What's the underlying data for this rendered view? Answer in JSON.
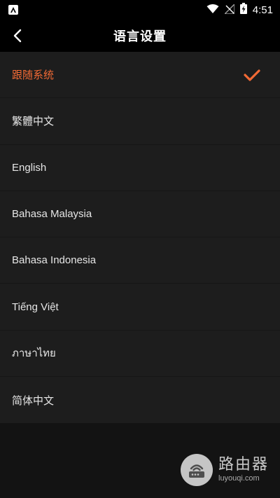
{
  "status_bar": {
    "time": "4:51",
    "icons": [
      "app-notification-icon",
      "wifi-icon",
      "no-sim-icon",
      "battery-charging-icon"
    ]
  },
  "header": {
    "title": "语言设置",
    "back_icon": "chevron-left-icon"
  },
  "languages": [
    {
      "label": "跟随系统",
      "selected": true
    },
    {
      "label": "繁體中文",
      "selected": false
    },
    {
      "label": "English",
      "selected": false
    },
    {
      "label": "Bahasa Malaysia",
      "selected": false
    },
    {
      "label": "Bahasa Indonesia",
      "selected": false
    },
    {
      "label": "Tiếng Việt",
      "selected": false
    },
    {
      "label": "ภาษาไทย",
      "selected": false
    },
    {
      "label": "简体中文",
      "selected": false
    }
  ],
  "colors": {
    "accent": "#f26a35",
    "background": "#131313",
    "list_background": "#1d1d1d",
    "header_background": "#000000"
  },
  "watermark": {
    "title": "路由器",
    "subtitle": "luyouqi.com"
  }
}
